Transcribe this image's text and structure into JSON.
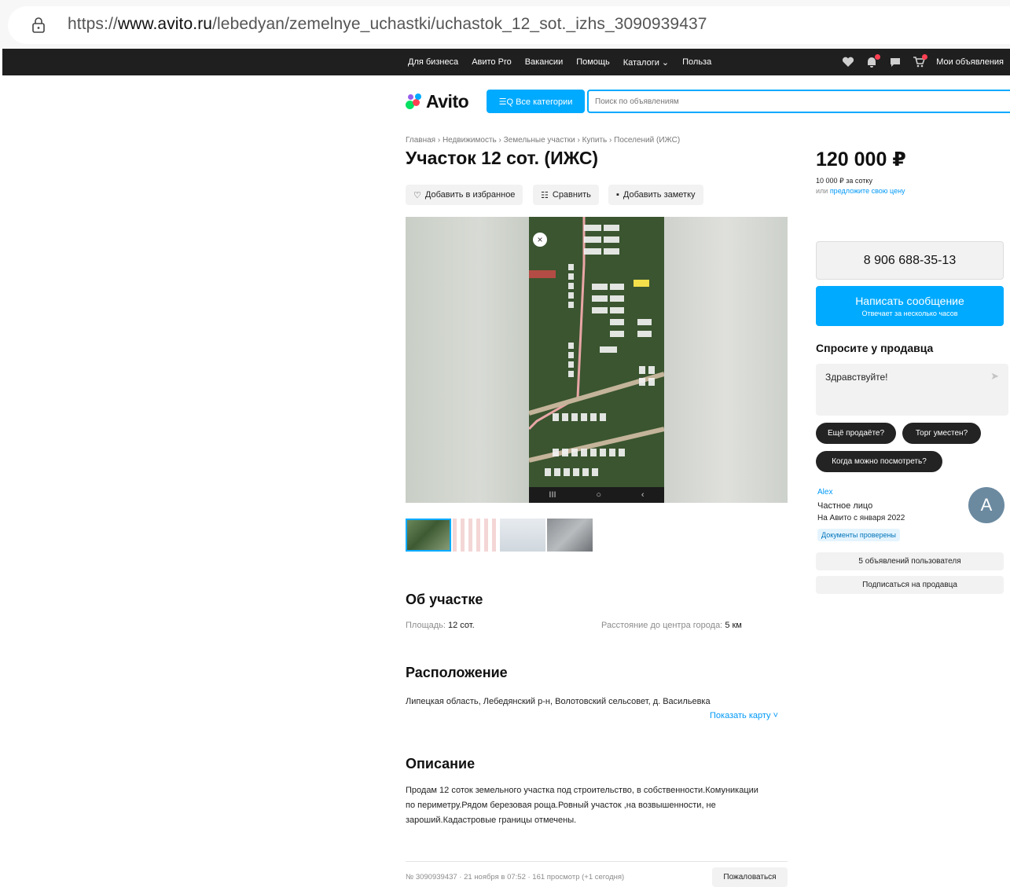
{
  "browser": {
    "url_prefix": "https://",
    "url_domain": "www.avito.ru",
    "url_path": "/lebedyan/zemelnye_uchastki/uchastok_12_sot._izhs_3090939437"
  },
  "topnav": {
    "items": [
      "Для бизнеса",
      "Авито Pro",
      "Вакансии",
      "Помощь",
      "Каталоги ⌄",
      "Польза"
    ],
    "my_ads": "Мои объявления"
  },
  "header": {
    "logo": "Avito",
    "categories_button": "☰Q Все категории",
    "search_placeholder": "Поиск по объявлениям"
  },
  "breadcrumb": "Главная › Недвижимость › Земельные участки › Купить › Поселений (ИЖС)",
  "title": "Участок 12 сот. (ИЖС)",
  "actions": {
    "favorite": "Добавить в избранное",
    "compare": "Сравнить",
    "note": "Добавить заметку"
  },
  "gallery": {
    "nav_glyphs": [
      "III",
      "○",
      "‹"
    ],
    "close_glyph": "×"
  },
  "about": {
    "heading": "Об участке",
    "area_label": "Площадь:",
    "area_value": "12 сот.",
    "distance_label": "Расстояние до центра города:",
    "distance_value": "5 км"
  },
  "location": {
    "heading": "Расположение",
    "address": "Липецкая область, Лебедянский р-н, Волотовский сельсовет, д. Васильевка",
    "show_map": "Показать карту ˅"
  },
  "description": {
    "heading": "Описание",
    "text": "Продам 12 соток земельного участка под строительство, в собственности.Комуникации по периметру.Рядом березовая роща.Ровный участок ,на возвышенности, не зароший.Кадастровые границы отмечены."
  },
  "footer": {
    "meta": "№ 3090939437 · 21 ноября в 07:52 · 161 просмотр (+1 сегодня)",
    "report": "Пожаловаться"
  },
  "price": {
    "value": "120 000 ₽",
    "per_sotka": "10 000 ₽ за сотку",
    "offer_prefix": "или ",
    "offer_link": "предложите свою цену"
  },
  "contact": {
    "phone": "8 906 688-35-13",
    "message_button": "Написать сообщение",
    "message_sub": "Отвечает за несколько часов"
  },
  "ask": {
    "title": "Спросите у продавца",
    "greeting": "Здравствуйте!",
    "send_glyph": "➤",
    "chips": [
      "Ещё продаёте?",
      "Торг уместен?",
      "Когда можно посмотреть?"
    ]
  },
  "seller": {
    "name": "Alex",
    "type": "Частное лицо",
    "since": "На Авито с января 2022",
    "verified": "Документы проверены",
    "avatar_letter": "A",
    "listings_button": "5 объявлений пользователя",
    "subscribe_button": "Подписаться на продавца"
  },
  "colors": {
    "accent": "#00aaff",
    "link": "#0099f7",
    "topbar": "#1f1f1f",
    "chip": "#232323"
  }
}
